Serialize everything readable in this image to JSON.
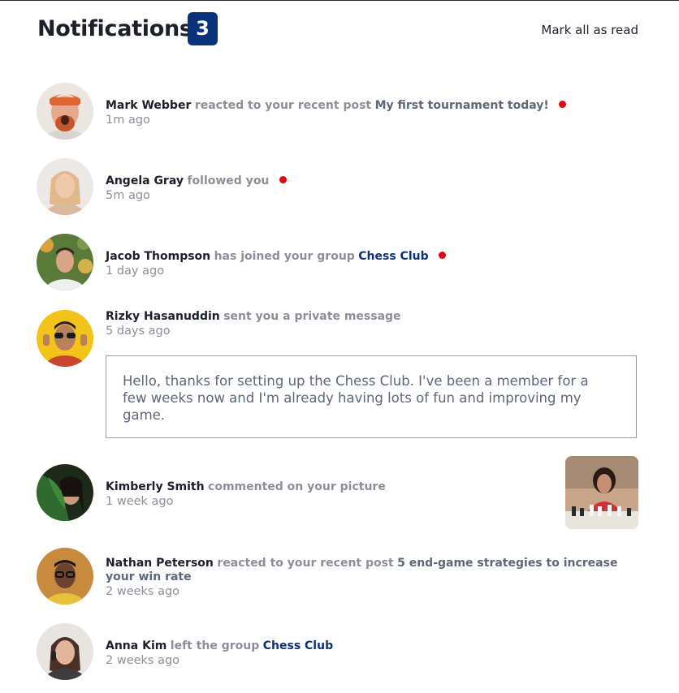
{
  "header": {
    "title": "Notifications",
    "unread_count": "3",
    "mark_all_label": "Mark all as read"
  },
  "colors": {
    "badge_bg": "#0a327b",
    "unread_dot": "#e3070f",
    "group_link": "#0a327b",
    "muted_text": "#8b8f98"
  },
  "notifications": [
    {
      "name": "Mark Webber",
      "action": "reacted to your recent post",
      "target": "My first tournament today!",
      "time": "1m ago",
      "unread": true
    },
    {
      "name": "Angela Gray",
      "action": "followed you",
      "target": "",
      "time": "5m ago",
      "unread": true
    },
    {
      "name": "Jacob Thompson",
      "action": "has joined your group",
      "target": "Chess Club",
      "time": "1 day ago",
      "unread": true
    },
    {
      "name": "Rizky Hasanuddin",
      "action": "sent you a private message",
      "target": "",
      "time": "5 days ago",
      "unread": false,
      "message": "Hello, thanks for setting up the Chess Club. I've been a member for a few weeks now and I'm already having lots of fun and improving my game."
    },
    {
      "name": "Kimberly Smith",
      "action": "commented on your picture",
      "target": "",
      "time": "1 week ago",
      "unread": false
    },
    {
      "name": "Nathan Peterson",
      "action": "reacted to your recent post",
      "target": "5 end-game strategies to increase your win rate",
      "time": "2 weeks ago",
      "unread": false
    },
    {
      "name": "Anna Kim",
      "action": "left the group",
      "target": "Chess Club",
      "time": "2 weeks ago",
      "unread": false
    }
  ]
}
